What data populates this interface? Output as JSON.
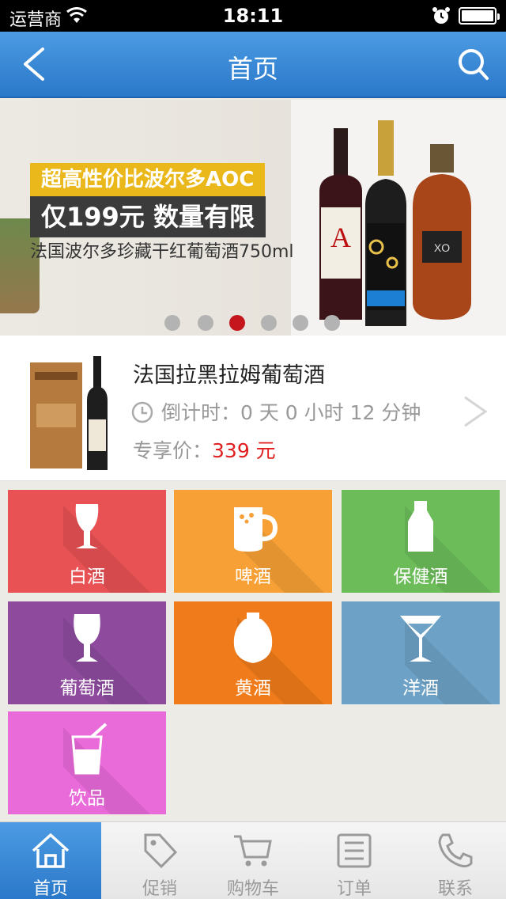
{
  "status_bar": {
    "carrier": "运营商",
    "time": "18:11"
  },
  "nav": {
    "title": "首页"
  },
  "banner": {
    "headline": "超高性价比波尔多AOC",
    "price_line": "仅199元 数量有限",
    "subtitle": "法国波尔多珍藏干红葡萄酒750ml",
    "slide_count": 6,
    "active_slide": 3
  },
  "promo": {
    "name": "法国拉黑拉姆葡萄酒",
    "countdown": "倒计时：0 天 0 小时 12 分钟",
    "price_label": "专享价：",
    "price_value": "339 元"
  },
  "categories": [
    {
      "label": "白酒",
      "color": "#e85254",
      "icon": "wine-glass-icon"
    },
    {
      "label": "啤酒",
      "color": "#f7a035",
      "icon": "beer-mug-icon"
    },
    {
      "label": "保健酒",
      "color": "#6cbd5a",
      "icon": "bottle-icon"
    },
    {
      "label": "葡萄酒",
      "color": "#8e4b9e",
      "icon": "goblet-icon"
    },
    {
      "label": "黄酒",
      "color": "#ef7b1a",
      "icon": "jar-icon"
    },
    {
      "label": "洋酒",
      "color": "#6da2c6",
      "icon": "cocktail-icon"
    },
    {
      "label": "饮品",
      "color": "#e96ad9",
      "icon": "drink-cup-icon"
    }
  ],
  "tabs": [
    {
      "label": "首页",
      "icon": "home-icon",
      "active": true
    },
    {
      "label": "促销",
      "icon": "tag-icon",
      "active": false
    },
    {
      "label": "购物车",
      "icon": "cart-icon",
      "active": false
    },
    {
      "label": "订单",
      "icon": "list-icon",
      "active": false
    },
    {
      "label": "联系",
      "icon": "phone-icon",
      "active": false
    }
  ]
}
